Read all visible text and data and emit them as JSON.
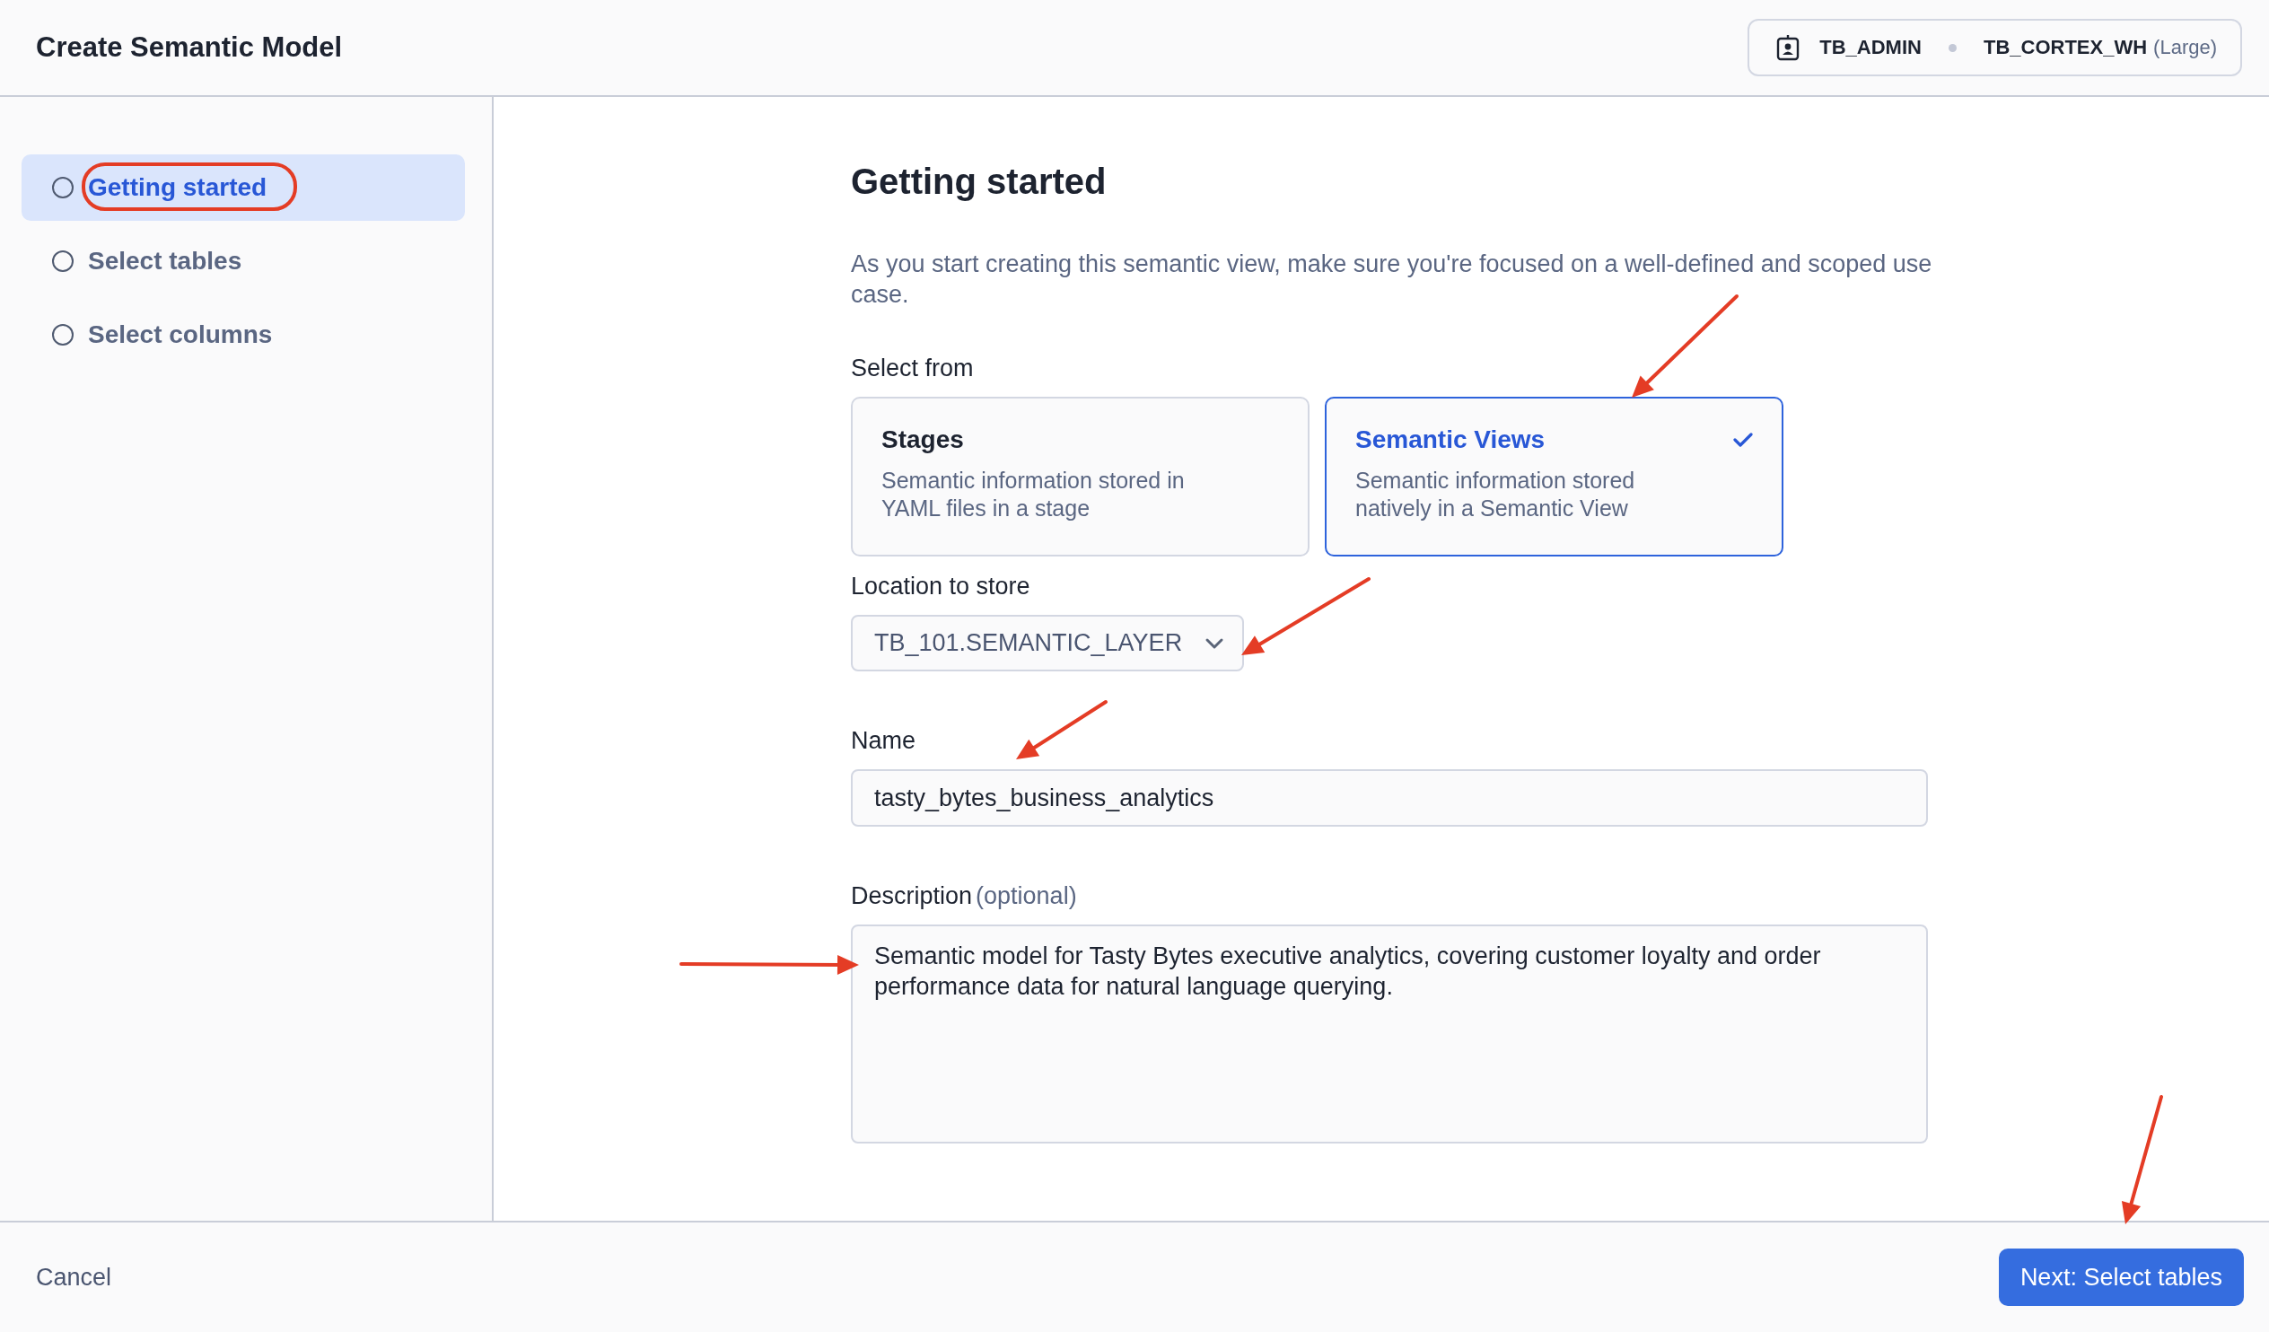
{
  "header": {
    "title": "Create Semantic Model",
    "role": "TB_ADMIN",
    "warehouse": "TB_CORTEX_WH",
    "warehouse_size": "(Large)"
  },
  "steps": [
    {
      "label": "Getting started",
      "selected": true
    },
    {
      "label": "Select tables",
      "selected": false
    },
    {
      "label": "Select columns",
      "selected": false
    }
  ],
  "main": {
    "heading": "Getting started",
    "intro": "As you start creating this semantic view, make sure you're focused on a well-defined and scoped use case.",
    "select_from": {
      "label": "Select from",
      "options": [
        {
          "title": "Stages",
          "description": "Semantic information stored in YAML files in a stage",
          "selected": false
        },
        {
          "title": "Semantic Views",
          "description": "Semantic information stored natively in a Semantic View",
          "selected": true
        }
      ]
    },
    "location": {
      "label": "Location to store",
      "value": "TB_101.SEMANTIC_LAYER"
    },
    "name": {
      "label": "Name",
      "value": "tasty_bytes_business_analytics"
    },
    "description": {
      "label": "Description",
      "optional": "(optional)",
      "value": "Semantic model for Tasty Bytes executive analytics, covering customer loyalty and order performance data for natural language querying."
    }
  },
  "footer": {
    "cancel": "Cancel",
    "next": "Next: Select tables"
  }
}
